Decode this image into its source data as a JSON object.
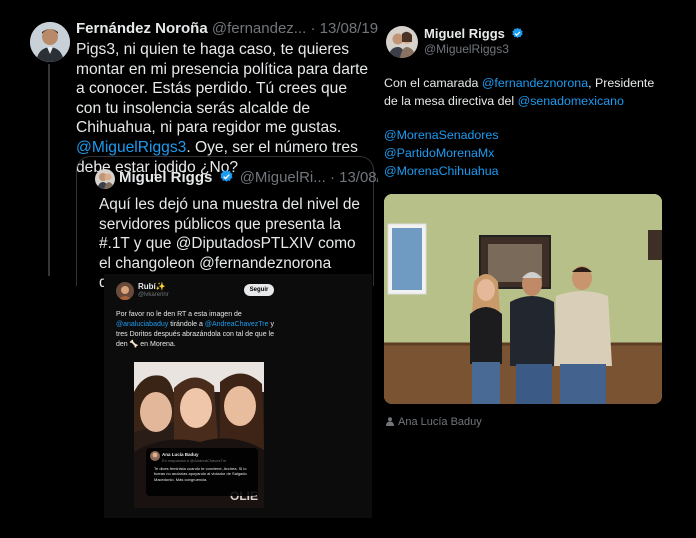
{
  "left_tweet": {
    "author_name": "Fernández Noroña",
    "author_handle": "@fernandez...",
    "date": "· 13/08/19",
    "body_part1": "Pigs3, ni quien te haga caso, te quieres montar en mi presencia política para darte a conocer. Estás perdido. Tú crees que con tu insolencia serás alcalde de Chihuahua, ni para regidor me gustas. ",
    "body_mention": "@MiguelRiggs3",
    "body_part2": ". Oye, ser el número tres debe estar jodido ¿No?"
  },
  "quoted_tweet": {
    "author_name": "Miguel Riggs",
    "author_handle": "@MiguelRi...",
    "date": "· 13/08/19",
    "body": "Aquí les dejó una muestra del nivel de servidores públicos que presenta la #.1T y que @DiputadosPTLXIV como el changoleon @fernandeznorona defiende y solapa!"
  },
  "embedded_screenshot": {
    "author_name": "Rubí✨",
    "author_handle": "@lvkarerinr",
    "follow_label": "Seguir",
    "body_part1": "Por favor no le den RT a esta imagen de ",
    "mention1": "@analuciabaduy",
    "body_part2": " tirándole a ",
    "mention2": "@AndreaChavezTre",
    "body_part3": " y tres Doritos después abrazándola con tal de que le den 🦴 en Morena.",
    "card": {
      "name": "Ana Lucía Baduy",
      "sub": "En respuesta a @AndreaChavezTre",
      "body": "Te dices feminista cuando te conviene, Andrea. Si lo fueras no andarías apoyando al violador de Salgado Macedonio. Más congruencia."
    }
  },
  "right_tweet": {
    "author_name": "Miguel Riggs",
    "author_handle": "@MiguelRiggs3",
    "body_part1": "Con el camarada ",
    "mention1": "@fernandeznorona",
    "body_part2": ", Presidente de la mesa directiva del ",
    "mention2": "@senadomexicano",
    "tags": [
      "@MorenaSenadores",
      "@PartidoMorenaMx",
      "@MorenaChihuahua"
    ],
    "photo_credit": "Ana Lucía Baduy"
  },
  "colors": {
    "background": "#000000",
    "text": "#e7e9ea",
    "muted": "#71767b",
    "link": "#1d9bf0",
    "verified": "#1d9bf0"
  }
}
